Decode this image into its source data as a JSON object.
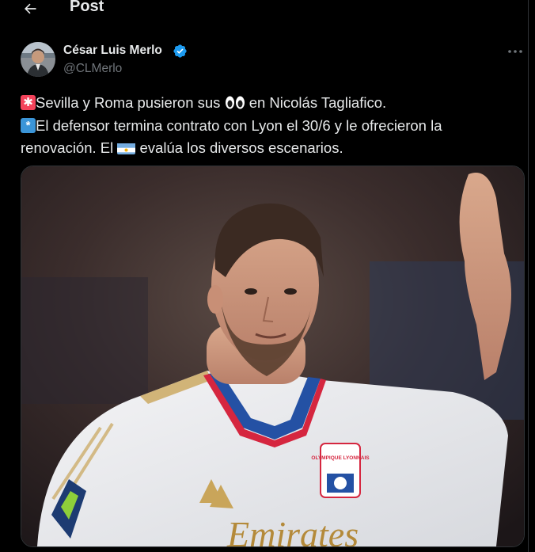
{
  "header": {
    "back_icon": "arrow-left-icon",
    "title": "Post"
  },
  "post": {
    "author": {
      "name": "César Luis Merlo",
      "handle": "@CLMerlo",
      "verified": true,
      "verified_color": "#1d9bf0",
      "avatar": "avatar-photo"
    },
    "more_icon": "more-dots-icon",
    "text_lines": [
      {
        "emoji": "police-siren-emoji",
        "before": "Sevilla y Roma pusieron sus",
        "eyes_emoji": "eyes-emoji",
        "after": "en Nicolás Tagliafico."
      },
      {
        "emoji": "asterisk-emoji",
        "text": "El defensor termina contrato con Lyon el 30/6 y le ofrecieron la"
      },
      {
        "before": "renovación. El",
        "flag_emoji": "argentina-flag-emoji",
        "after": "evalúa los diversos escenarios."
      }
    ],
    "media": {
      "type": "photo",
      "description_icon": "footballer-photo",
      "jersey_sponsor_visible": "Emirates",
      "badge_text": "OLYMPIQUE LYONNAIS"
    }
  },
  "colors": {
    "background": "#000000",
    "text": "#e7e9ea",
    "secondary": "#71767b",
    "border": "#2f3336"
  }
}
